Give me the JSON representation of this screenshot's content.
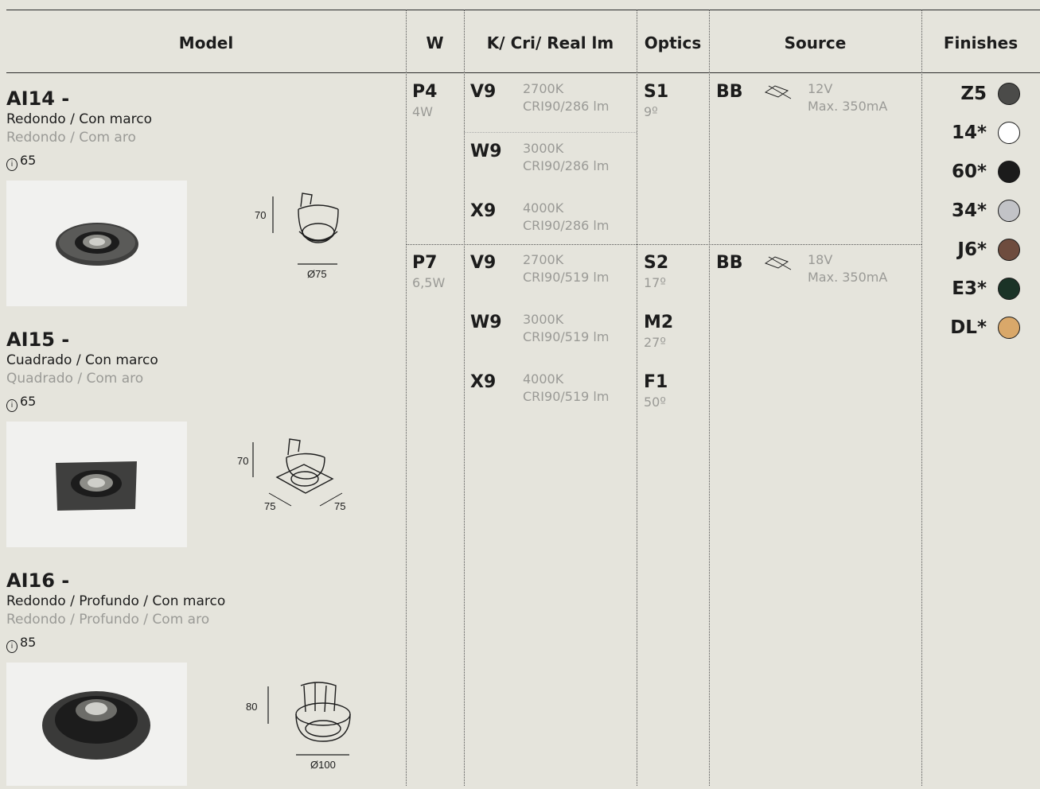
{
  "header": {
    "model": "Model",
    "w": "W",
    "k_cri": "K/ Cri/ Real lm",
    "optics": "Optics",
    "source": "Source",
    "finishes": "Finishes"
  },
  "models": [
    {
      "name": "AI14 -",
      "desc_es": "Redondo / Con marco",
      "desc_pt": "Redondo / Com aro",
      "ip": "65",
      "dims": {
        "h": "70",
        "d": "Ø75"
      }
    },
    {
      "name": "AI15 -",
      "desc_es": "Cuadrado / Con marco",
      "desc_pt": "Quadrado / Com aro",
      "ip": "65",
      "dims": {
        "h": "70",
        "w1": "75",
        "w2": "75"
      }
    },
    {
      "name": "AI16 -",
      "desc_es": "Redondo / Profundo / Con marco",
      "desc_pt": "Redondo / Profundo / Com aro",
      "ip": "85",
      "dims": {
        "h": "80",
        "d": "Ø100"
      }
    }
  ],
  "groups": [
    {
      "w_code": "P4",
      "w_val": "4W",
      "temps": [
        {
          "code": "V9",
          "k": "2700K",
          "cri": "CRI90/286 lm"
        },
        {
          "code": "W9",
          "k": "3000K",
          "cri": "CRI90/286 lm"
        },
        {
          "code": "X9",
          "k": "4000K",
          "cri": "CRI90/286 lm"
        }
      ],
      "optics": [
        {
          "code": "S1",
          "angle": "9º"
        }
      ],
      "source": {
        "code": "BB",
        "v": "12V",
        "ma": "Max. 350mA"
      }
    },
    {
      "w_code": "P7",
      "w_val": "6,5W",
      "temps": [
        {
          "code": "V9",
          "k": "2700K",
          "cri": "CRI90/519 lm"
        },
        {
          "code": "W9",
          "k": "3000K",
          "cri": "CRI90/519 lm"
        },
        {
          "code": "X9",
          "k": "4000K",
          "cri": "CRI90/519 lm"
        }
      ],
      "optics": [
        {
          "code": "S2",
          "angle": "17º"
        },
        {
          "code": "M2",
          "angle": "27º"
        },
        {
          "code": "F1",
          "angle": "50º"
        }
      ],
      "source": {
        "code": "BB",
        "v": "18V",
        "ma": "Max. 350mA"
      }
    }
  ],
  "finishes": [
    {
      "code": "Z5",
      "color": "#4b4b49"
    },
    {
      "code": "14*",
      "color": "#ffffff"
    },
    {
      "code": "60*",
      "color": "#1b1b1b"
    },
    {
      "code": "34*",
      "color": "#c2c3c7"
    },
    {
      "code": "J6*",
      "color": "#6e4c3e"
    },
    {
      "code": "E3*",
      "color": "#1b3327"
    },
    {
      "code": "DL*",
      "color": "#d9a86a"
    }
  ]
}
